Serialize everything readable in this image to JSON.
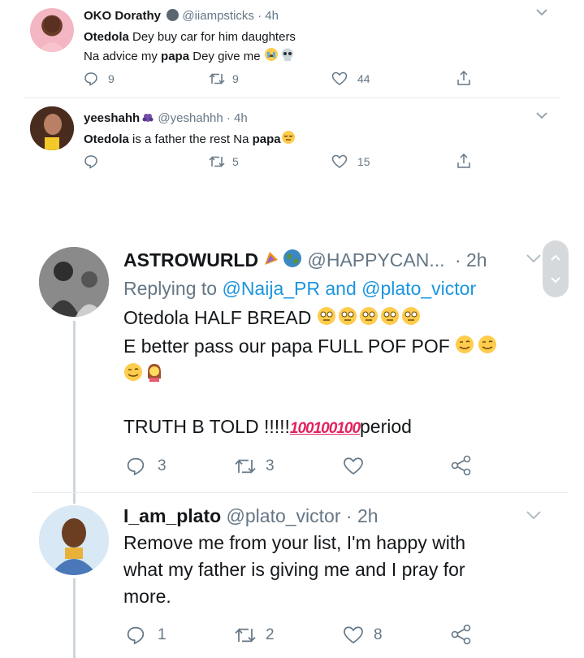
{
  "tweets_small": [
    {
      "name": "OKO Dorathy",
      "handle": "@iiampsticks",
      "time": "· 4h",
      "line1_bold": "Otedola",
      "line1_rest": " Dey buy car for him daughters",
      "line2_a": "Na advice my ",
      "line2_bold": "papa",
      "line2_b": " Dey give me ",
      "reply_count": "9",
      "retweet_count": "9",
      "like_count": "44"
    },
    {
      "name": "yeeshahh",
      "handle": "@yeshahhh",
      "time": "· 4h",
      "line1_bold": "Otedola",
      "line1_rest": " is a father the rest Na ",
      "line1_bold2": "papa",
      "reply_count": "",
      "retweet_count": "5",
      "like_count": "15"
    }
  ],
  "tweets_big": [
    {
      "name": "ASTROWURLD",
      "handle": "@HAPPYCAN...",
      "time": "· 2h",
      "reply_prefix": "Replying to ",
      "mention1": "@Naija_PR",
      "reply_and": " and ",
      "mention2": "@plato_victor",
      "line1": "Otedola HALF BREAD ",
      "line2": "E better pass our papa FULL POF POF ",
      "line4_a": "TRUTH B TOLD !!!!!",
      "line4_hundreds": "100100100",
      "line4_b": "period",
      "reply_count": "3",
      "retweet_count": "3",
      "like_count": ""
    },
    {
      "name": "I_am_plato",
      "handle": "@plato_victor",
      "time": "· 2h",
      "line1": "Remove me from your list, I'm happy with",
      "line2": "what my father is giving me and I pray for",
      "line3": "more.",
      "reply_count": "1",
      "retweet_count": "2",
      "like_count": "8"
    }
  ],
  "icons": {
    "reply": "reply-icon",
    "retweet": "retweet-icon",
    "like": "heart-icon",
    "share": "share-icon",
    "caret": "chevron-down-icon"
  },
  "colors": {
    "mention_blue": "#1b95e0",
    "muted": "#657786",
    "hundred_red": "#e0245e"
  }
}
